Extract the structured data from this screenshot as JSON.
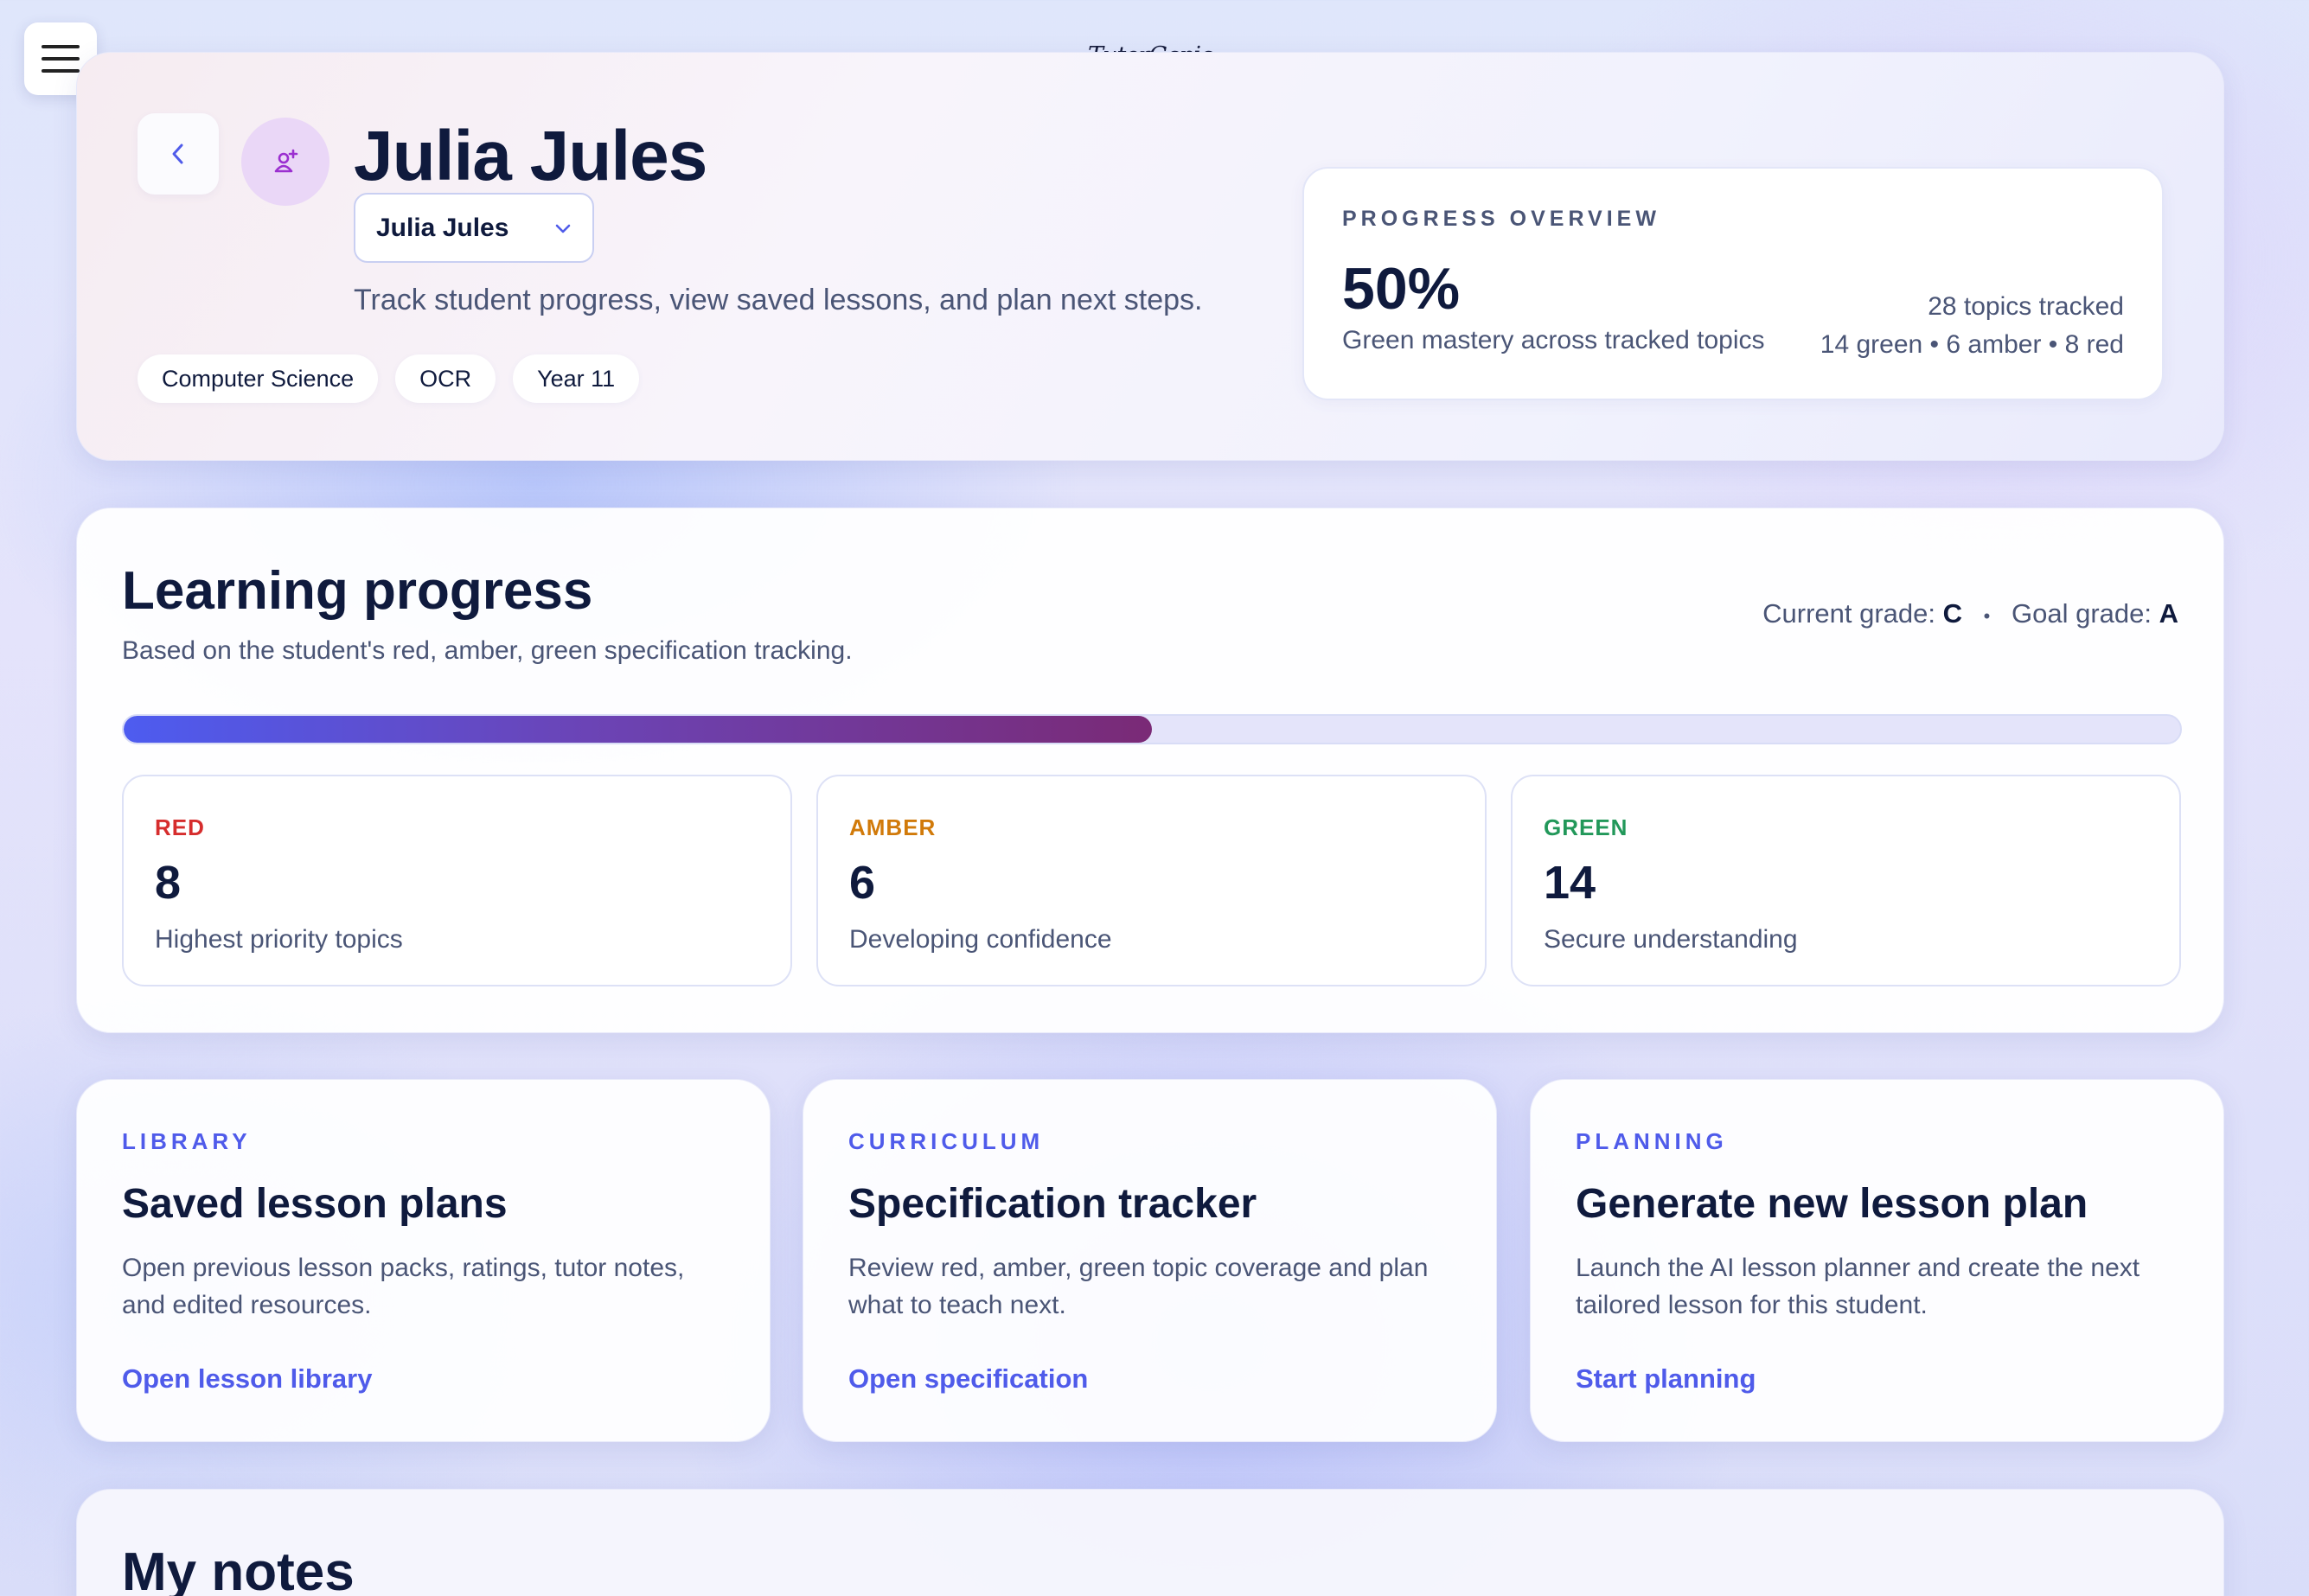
{
  "brand": {
    "logo_text": "TutorGenie"
  },
  "header": {
    "student_name": "Julia Jules",
    "student_select": {
      "selected": "Julia Jules"
    },
    "subtitle": "Track student progress, view saved lessons, and plan next steps.",
    "tags": [
      "Computer Science",
      "OCR",
      "Year 11"
    ]
  },
  "overview": {
    "label": "PROGRESS OVERVIEW",
    "percent": "50%",
    "percent_value": 0.5,
    "description": "Green mastery across tracked topics",
    "topics_tracked": "28 topics tracked",
    "breakdown": "14 green • 6 amber • 8 red"
  },
  "learning_progress": {
    "title": "Learning progress",
    "subtitle": "Based on the student's red, amber, green specification tracking.",
    "current_grade_label": "Current grade:",
    "current_grade": "C",
    "separator": "•",
    "goal_grade_label": "Goal grade:",
    "goal_grade": "A",
    "progress_fraction": 0.5,
    "rag": [
      {
        "label": "RED",
        "count": "8",
        "description": "Highest priority topics",
        "color": "#d62d2d"
      },
      {
        "label": "AMBER",
        "count": "6",
        "description": "Developing confidence",
        "color": "#d17a0a"
      },
      {
        "label": "GREEN",
        "count": "14",
        "description": "Secure understanding",
        "color": "#22985a"
      }
    ]
  },
  "features": [
    {
      "kicker": "LIBRARY",
      "title": "Saved lesson plans",
      "description": "Open previous lesson packs, ratings, tutor notes, and edited resources.",
      "link": "Open lesson library"
    },
    {
      "kicker": "CURRICULUM",
      "title": "Specification tracker",
      "description": "Review red, amber, green topic coverage and plan what to teach next.",
      "link": "Open specification"
    },
    {
      "kicker": "PLANNING",
      "title": "Generate new lesson plan",
      "description": "Launch the AI lesson planner and create the next tailored lesson for this student.",
      "link": "Start planning"
    }
  ],
  "notes": {
    "title": "My notes"
  },
  "colors": {
    "accent": "#4f5bea",
    "heading": "#0f1a3d",
    "muted": "#4a5576"
  },
  "icons": {
    "menu": "hamburger-icon",
    "back": "chevron-left-icon",
    "avatar": "user-icon",
    "select": "chevron-down-icon"
  }
}
